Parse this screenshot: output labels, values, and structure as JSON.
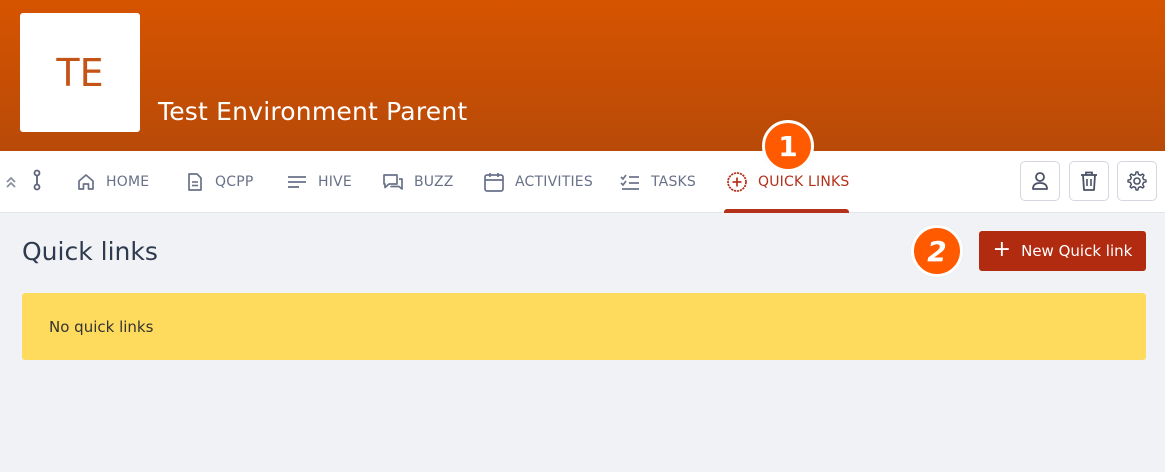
{
  "org": {
    "initials": "TE",
    "name": "Test Environment Parent"
  },
  "nav": {
    "items": [
      {
        "label": "HOME",
        "icon": "home-icon"
      },
      {
        "label": "QCPP",
        "icon": "document-icon"
      },
      {
        "label": "HIVE",
        "icon": "lines-icon"
      },
      {
        "label": "BUZZ",
        "icon": "chat-icon"
      },
      {
        "label": "ACTIVITIES",
        "icon": "calendar-icon"
      },
      {
        "label": "TASKS",
        "icon": "checklist-icon"
      },
      {
        "label": "QUICK LINKS",
        "icon": "plus-circle-icon",
        "active": true
      }
    ],
    "tools": [
      "user-icon",
      "trash-icon",
      "gear-icon"
    ]
  },
  "badges": {
    "one": "1",
    "two": "2"
  },
  "page": {
    "title": "Quick links",
    "new_button_label": "New Quick link",
    "empty_message": "No quick links"
  },
  "colors": {
    "header": "#d65400",
    "accent": "#b3311a",
    "button": "#b12b10",
    "alert": "#fedb5c",
    "badge": "#ff5a00"
  }
}
